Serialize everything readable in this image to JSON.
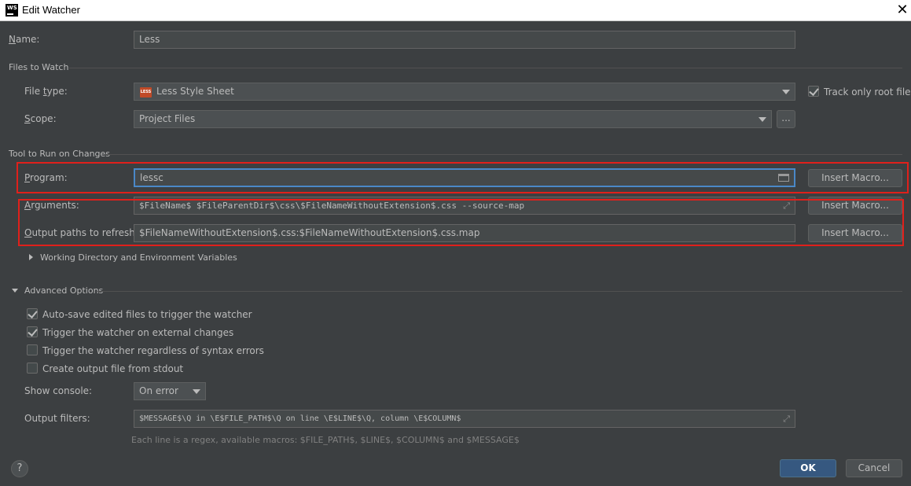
{
  "window": {
    "app_icon_text": "WS",
    "title": "Edit Watcher"
  },
  "name": {
    "label_u": "N",
    "label_rest": "ame:",
    "value": "Less"
  },
  "files_to_watch": {
    "section_title": "Files to Watch",
    "file_type_label_pre": "File ",
    "file_type_label_u": "t",
    "file_type_label_post": "ype:",
    "file_type_value": "Less Style Sheet",
    "file_type_icon_text": "LESS",
    "track_root_label": "Track only root files",
    "track_root_checked": true,
    "scope_label_u": "S",
    "scope_label_rest": "cope:",
    "scope_value": "Project Files",
    "scope_more_label": "..."
  },
  "tool_to_run": {
    "section_title": "Tool to Run on Changes",
    "program_label_u": "P",
    "program_label_rest": "rogram:",
    "program_value": "lessc",
    "arguments_label_u": "A",
    "arguments_label_rest": "rguments:",
    "arguments_value": "$FileName$ $FileParentDir$\\css\\$FileNameWithoutExtension$.css --source-map",
    "output_paths_label_u": "O",
    "output_paths_label_rest": "utput paths to refresh:",
    "output_paths_value": "$FileNameWithoutExtension$.css:$FileNameWithoutExtension$.css.map",
    "insert_macro_label": "Insert Macro...",
    "working_dir_label": "Working Directory and Environment Variables"
  },
  "advanced": {
    "section_title": "Advanced Options",
    "options": [
      {
        "label": "Auto-save edited files to trigger the watcher",
        "checked": true
      },
      {
        "label": "Trigger the watcher on external changes",
        "checked": true
      },
      {
        "label": "Trigger the watcher regardless of syntax errors",
        "checked": false
      },
      {
        "label": "Create output file from stdout",
        "checked": false
      }
    ],
    "show_console_label": "Show console:",
    "show_console_value": "On error",
    "output_filters_label": "Output filters:",
    "output_filters_value": "$MESSAGE$\\Q in \\E$FILE_PATH$\\Q on line \\E$LINE$\\Q, column \\E$COLUMN$",
    "hint": "Each line is a regex, available macros: $FILE_PATH$, $LINE$, $COLUMN$ and $MESSAGE$"
  },
  "footer": {
    "help_label": "?",
    "ok_label": "OK",
    "cancel_label": "Cancel"
  },
  "colors": {
    "background": "#3c3f41",
    "field": "#45494a",
    "highlight_border": "#e0201b",
    "ok_button": "#365880",
    "focus_border": "#4a88c7"
  }
}
